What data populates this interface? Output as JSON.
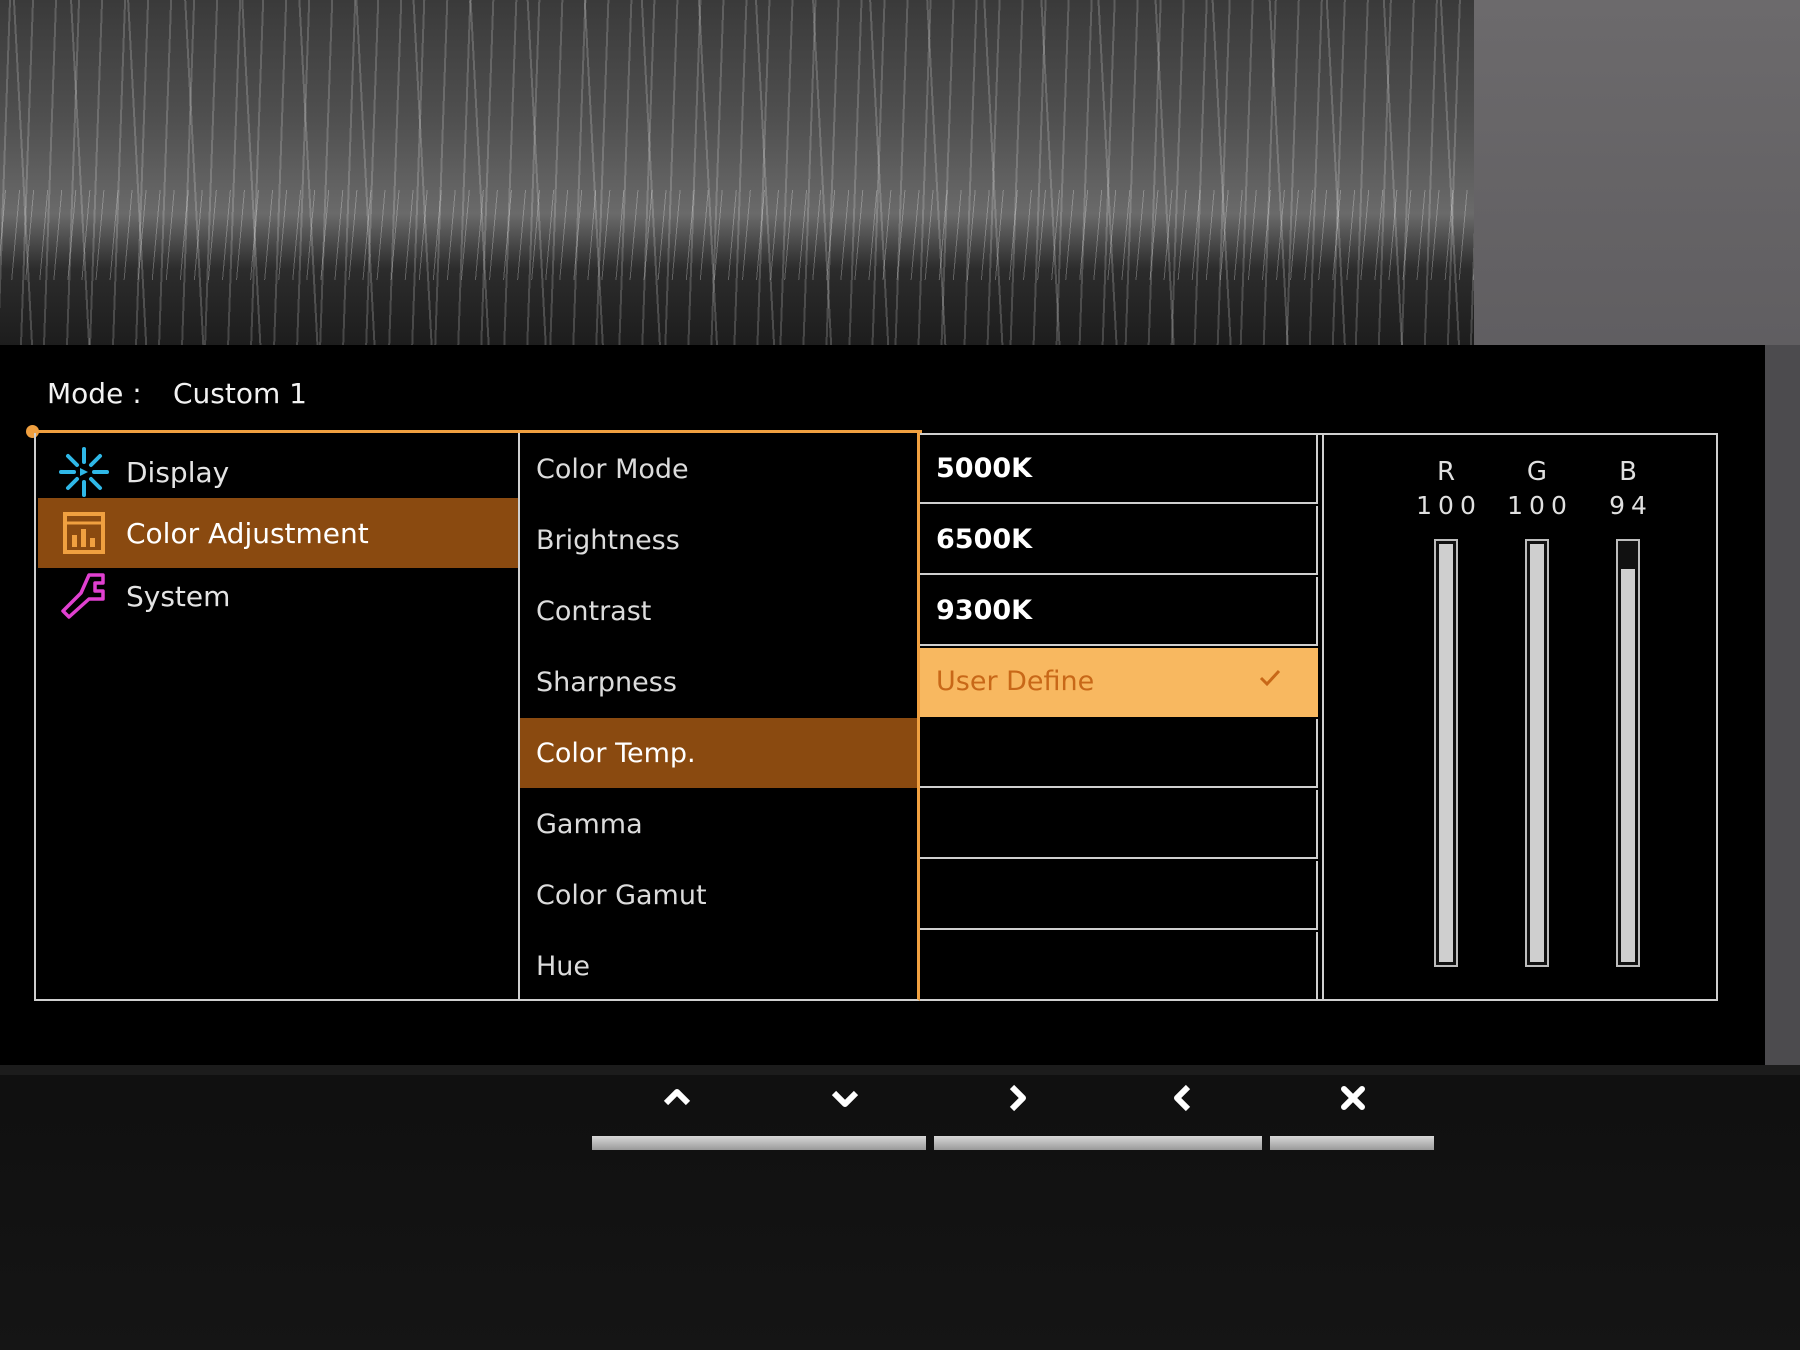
{
  "mode": {
    "label": "Mode :",
    "value": "Custom 1"
  },
  "main_menu": [
    {
      "label": "Display",
      "icon": "display-sparkle-icon",
      "color": "#2fb8e8",
      "active": false
    },
    {
      "label": "Color Adjustment",
      "icon": "color-chart-icon",
      "color": "#f0a040",
      "active": true
    },
    {
      "label": "System",
      "icon": "wrench-icon",
      "color": "#e040d0",
      "active": false
    }
  ],
  "submenu": [
    {
      "label": "Color Mode",
      "active": false
    },
    {
      "label": "Brightness",
      "active": false
    },
    {
      "label": "Contrast",
      "active": false
    },
    {
      "label": "Sharpness",
      "active": false
    },
    {
      "label": "Color Temp.",
      "active": true
    },
    {
      "label": "Gamma",
      "active": false
    },
    {
      "label": "Color Gamut",
      "active": false
    },
    {
      "label": "Hue",
      "active": false
    }
  ],
  "options": [
    {
      "label": "5000K",
      "selected": false
    },
    {
      "label": "6500K",
      "selected": false
    },
    {
      "label": "9300K",
      "selected": false
    },
    {
      "label": "User Define",
      "selected": true
    }
  ],
  "rgb": [
    {
      "label": "R",
      "value": "100",
      "level": 100
    },
    {
      "label": "G",
      "value": "100",
      "level": 100
    },
    {
      "label": "B",
      "value": "94",
      "level": 94
    }
  ],
  "keys": [
    {
      "icon": "chevron-up-icon"
    },
    {
      "icon": "chevron-down-icon"
    },
    {
      "icon": "chevron-right-icon"
    },
    {
      "icon": "chevron-left-icon"
    },
    {
      "icon": "close-icon"
    }
  ],
  "colors": {
    "accent": "#f0a040",
    "active_bg": "#8a4a10",
    "selected_bg": "#f8b860"
  }
}
